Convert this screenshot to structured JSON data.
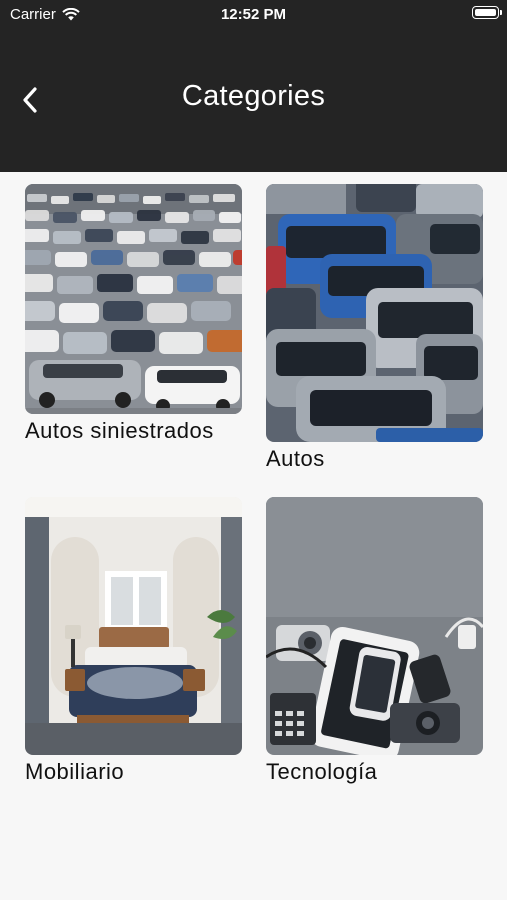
{
  "status_bar": {
    "carrier": "Carrier",
    "time": "12:52 PM"
  },
  "header": {
    "title": "Categories"
  },
  "categories": [
    {
      "label": "Autos siniestrados",
      "image": "parking-lot-photo"
    },
    {
      "label": "Autos",
      "image": "parked-cars-photo"
    },
    {
      "label": "Mobiliario",
      "image": "bedroom-photo"
    },
    {
      "label": "Tecnología",
      "image": "electronics-photo"
    }
  ],
  "colors": {
    "header_bg": "#242424",
    "page_bg": "#f7f7f7",
    "text": "#111111"
  }
}
